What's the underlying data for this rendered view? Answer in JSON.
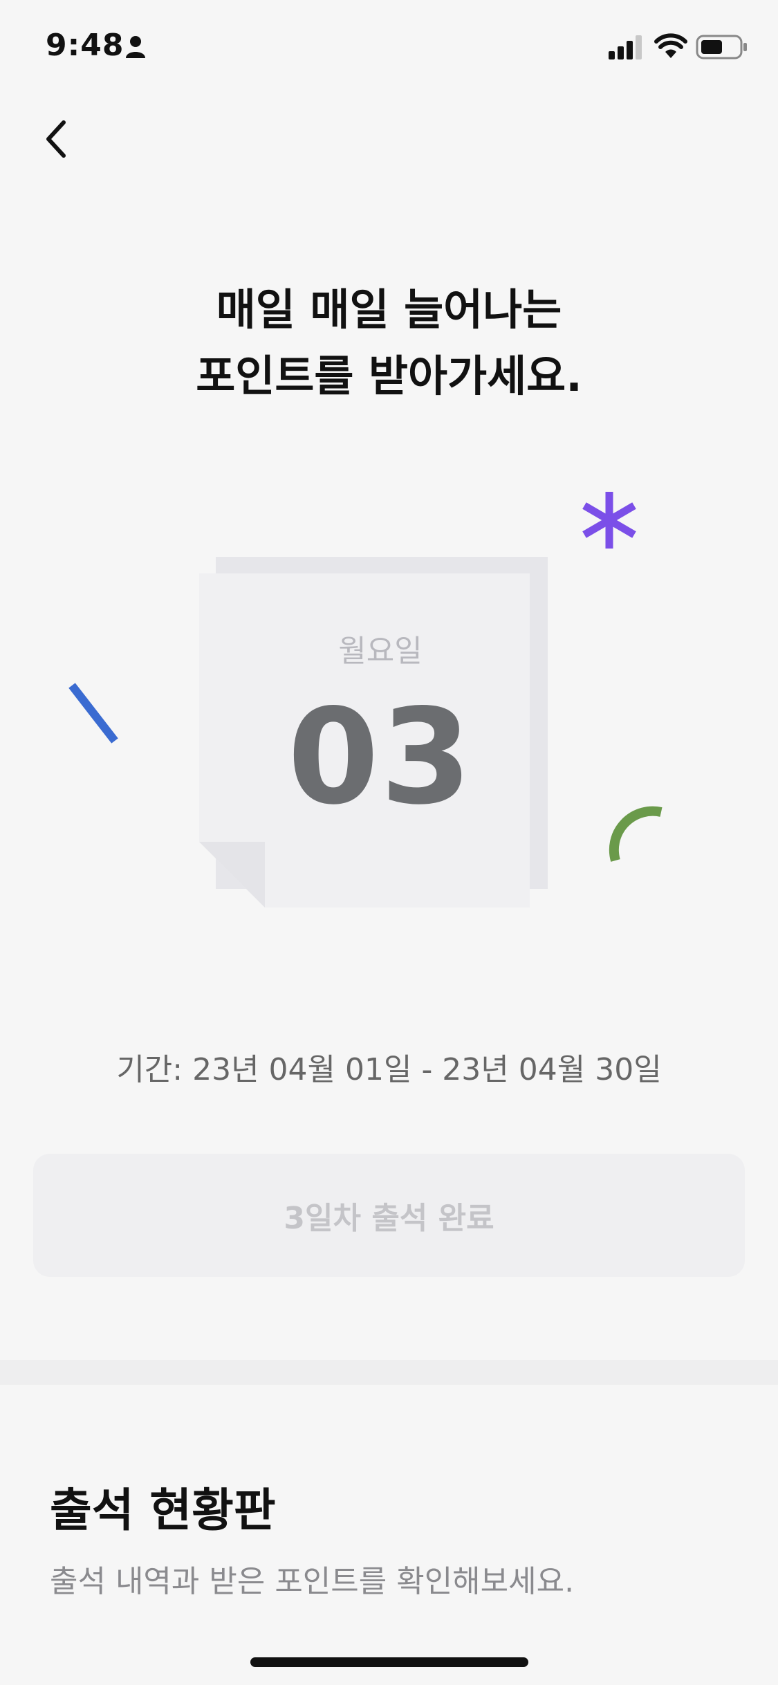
{
  "status_bar": {
    "time": "9:48",
    "icons": [
      "person-icon",
      "signal-icon",
      "wifi-icon",
      "battery-icon"
    ]
  },
  "nav": {
    "back_icon": "chevron-left-icon"
  },
  "headline": {
    "line1": "매일 매일 늘어나는",
    "line2": "포인트를 받아가세요."
  },
  "calendar": {
    "weekday": "월요일",
    "day": "03"
  },
  "period": {
    "text": "기간: 23년 04월 01일 - 23년 04월 30일"
  },
  "attendance_button": {
    "label": "3일차 출석 완료",
    "enabled": false
  },
  "board": {
    "title": "출석 현황판",
    "subtitle": "출석 내역과 받은 포인트를 확인해보세요."
  },
  "colors": {
    "background": "#f6f6f6",
    "accent_purple": "#7b4fe8",
    "accent_blue": "#3a6bd1",
    "accent_green": "#6a9a4a",
    "day_number": "#6b6d70"
  }
}
